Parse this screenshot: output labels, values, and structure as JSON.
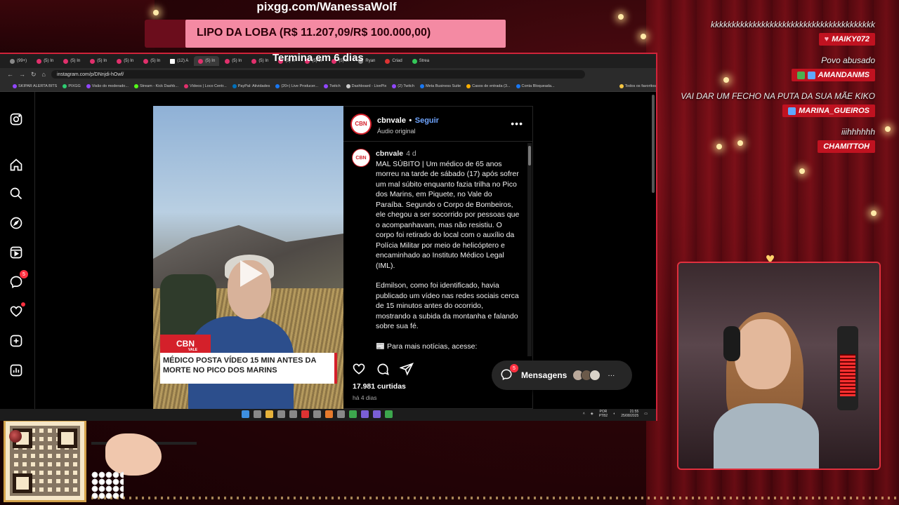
{
  "overlay": {
    "pix_url": "pixgg.com/WanessaWolf",
    "goal_text": "LIPO DA LOBA (R$ 11.207,09/R$ 100.000,00)",
    "goal_progress": 0.112,
    "goal_deadline": "Termina em 6 dias"
  },
  "chat": [
    {
      "text": "kkkkkkkkkkkkkkkkkkkkkkkkkkkkkkkkkkkkkkk",
      "name": "MAIKY072",
      "badge": "heart"
    },
    {
      "text": "Povo abusado",
      "name": "AMANDANMS",
      "badge": "green"
    },
    {
      "text": "VAI DAR UM FECHO NA PUTA DA SUA MÃE KIKO",
      "name": "MARINA_GUEIROS",
      "badge": "blue"
    },
    {
      "text": "iiihhhhhh",
      "name": "CHAMITTOH",
      "badge": ""
    }
  ],
  "browser": {
    "tabs": [
      "(99+) ",
      "(5) In",
      "(5) In",
      "(5) In",
      "(5) In",
      "(5) In",
      "(12) A",
      "(5) In",
      "(5) In",
      "(5) In",
      "(5) In",
      "(5) In",
      "(5) In",
      "Ryan",
      "Criad",
      "Strea"
    ],
    "url": "instagram.com/p/DNnjdi-hOwf/",
    "bookmarks": [
      "SKIPAR ALERTA BITS",
      "PIXGG",
      "Visão do moderado...",
      "Stream - Kick Dashb...",
      "Vídeos | Loco Centr...",
      "PayPal: Atividades",
      "(20+) Live Producer...",
      "Twitch",
      "Dashboard - LivePix",
      "(2) Twitch",
      "Meta Business Suite",
      "Casos de entrada (3...",
      "Conta Bloqueada...",
      "Todos os favoritos"
    ]
  },
  "sidebar": {
    "message_badge": "5"
  },
  "video": {
    "brand": "CBN",
    "brand_sub": "VALE",
    "caption": "MÉDICO POSTA VÍDEO 15 MIN ANTES DA MORTE NO PICO DOS MARINS"
  },
  "post": {
    "username": "cbnvale",
    "follow_label": "Seguir",
    "separator": "•",
    "audio": "Áudio original",
    "avatar_text": "CBN",
    "time_ago": "4 d",
    "para1": "MAL SÚBITO | Um médico de 65 anos morreu na tarde de sábado (17) após sofrer um mal súbito enquanto fazia trilha no Pico dos Marins, em Piquete, no Vale do Paraíba. Segundo o Corpo de Bombeiros, ele chegou a ser socorrido por pessoas que o acompanhavam, mas não resistiu. O corpo foi retirado do local com o auxílio da Polícia Militar por meio de helicóptero e encaminhado ao Instituto Médico Legal (IML).",
    "para2": "Edmilson, como foi identificado, havia publicado um vídeo nas redes sociais cerca de 15 minutos antes do ocorrido, mostrando a subida da montanha e falando sobre sua fé.",
    "para3": "📰 Para mais notícias, acesse:",
    "likes": "17.981 curtidas",
    "date": "há 4 dias"
  },
  "messages": {
    "label": "Mensagens",
    "badge": "5",
    "more": "···"
  },
  "taskbar": {
    "lang1": "POR",
    "lang2": "PTB2",
    "time": "21:55",
    "date": "25/08/2025"
  }
}
